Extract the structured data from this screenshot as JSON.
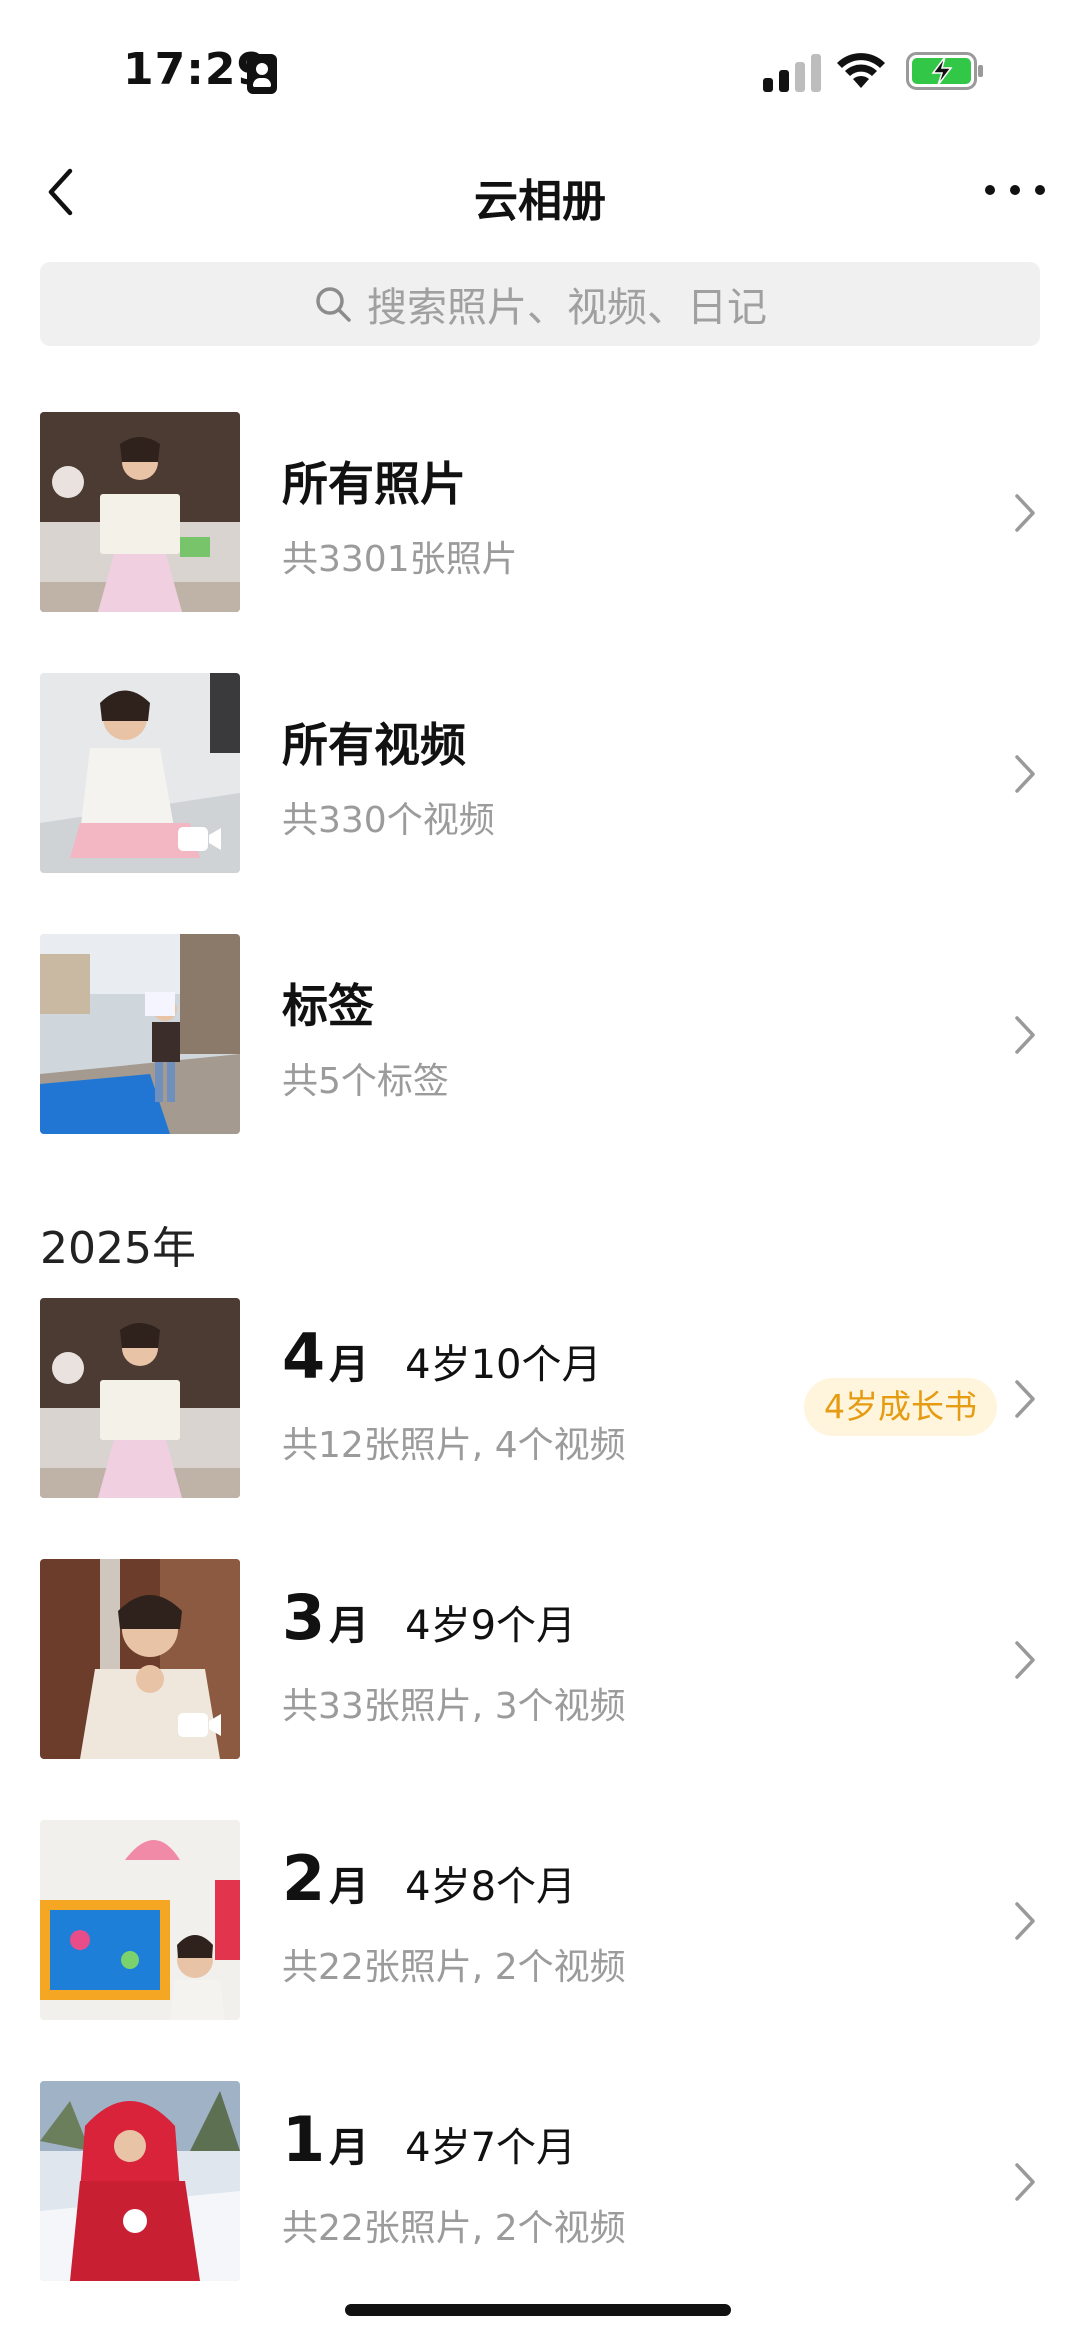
{
  "status_bar": {
    "time": "17:29",
    "icons": [
      "sim-card-icon",
      "signal-icon",
      "wifi-icon",
      "battery-charging-icon"
    ]
  },
  "nav": {
    "title": "云相册",
    "back_icon": "chevron-left-icon",
    "more_icon": "more-icon"
  },
  "search": {
    "placeholder": "搜索照片、视频、日记",
    "icon": "search-icon"
  },
  "categories": [
    {
      "title": "所有照片",
      "subtitle": "共3301张照片",
      "video": false
    },
    {
      "title": "所有视频",
      "subtitle": "共330个视频",
      "video": true
    },
    {
      "title": "标签",
      "subtitle": "共5个标签",
      "video": false
    }
  ],
  "year_label": "2025年",
  "months": [
    {
      "num": "4",
      "unit": "月",
      "age": "4岁10个月",
      "subtitle": "共12张照片, 4个视频",
      "badge": "4岁成长书",
      "video": false
    },
    {
      "num": "3",
      "unit": "月",
      "age": "4岁9个月",
      "subtitle": "共33张照片, 3个视频",
      "badge": "",
      "video": true
    },
    {
      "num": "2",
      "unit": "月",
      "age": "4岁8个月",
      "subtitle": "共22张照片, 2个视频",
      "badge": "",
      "video": false
    },
    {
      "num": "1",
      "unit": "月",
      "age": "4岁7个月",
      "subtitle": "共22张照片, 2个视频",
      "badge": "",
      "video": false
    }
  ],
  "colors": {
    "accent_badge_text": "#e59c12",
    "accent_badge_bg": "#fff4dc",
    "subtitle_gray": "#9b9b9b",
    "search_bg": "#f0f0f0"
  }
}
